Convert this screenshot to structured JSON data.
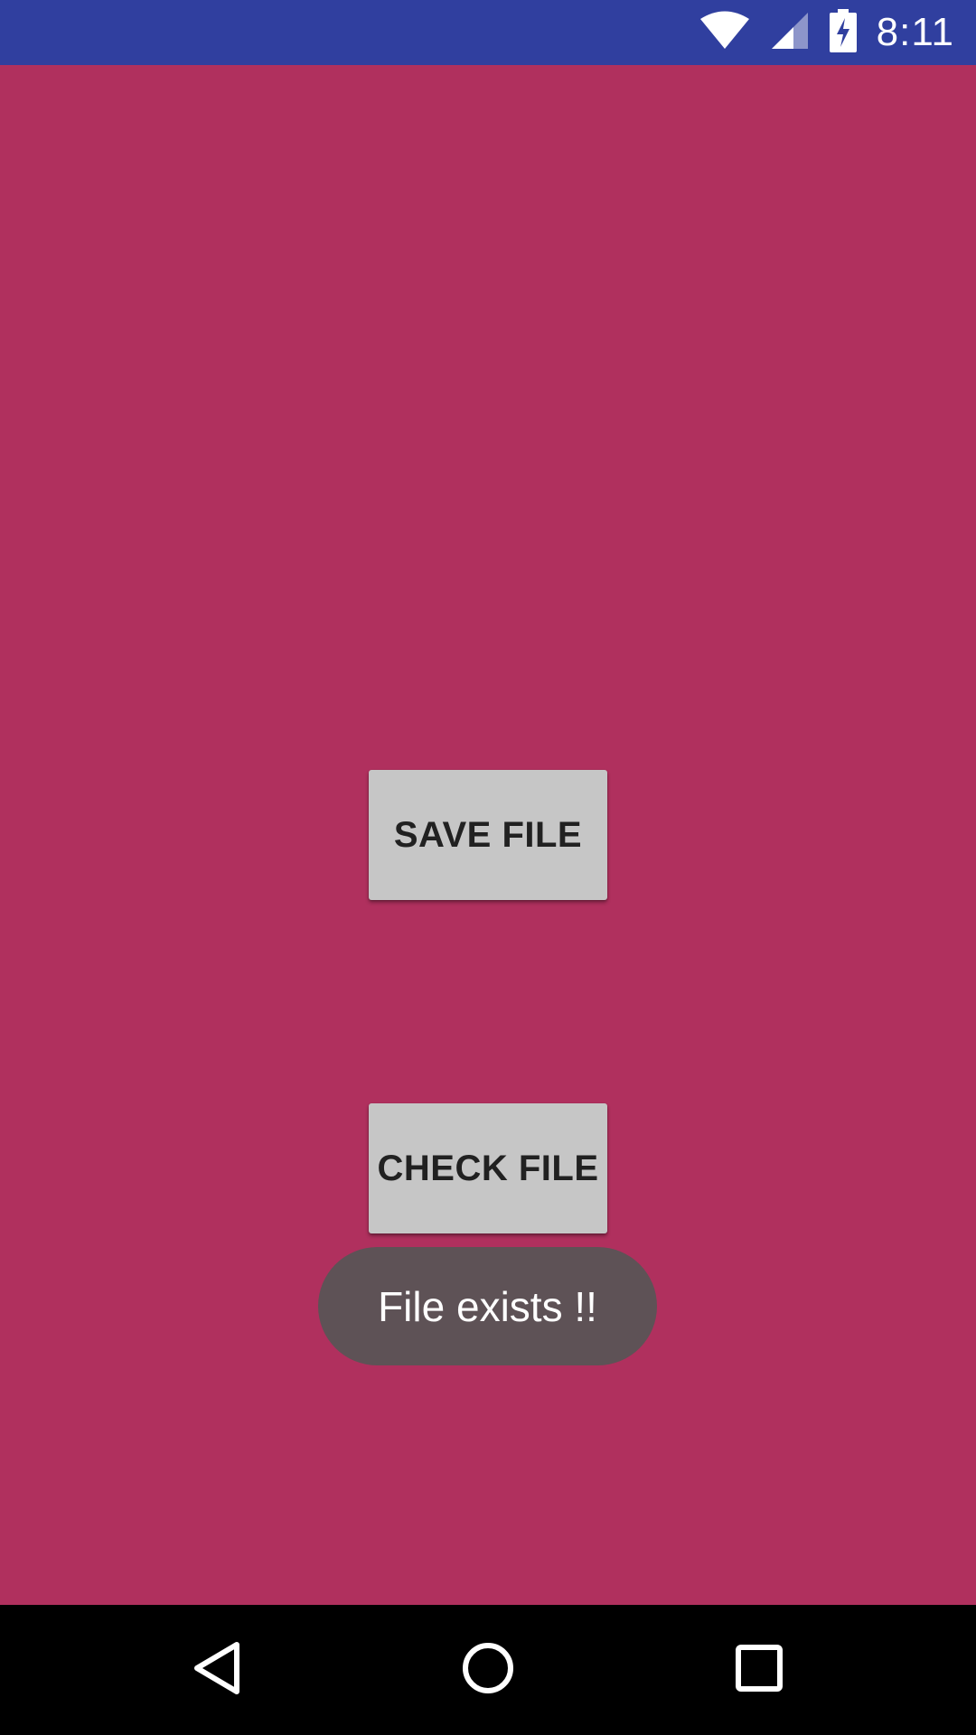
{
  "colors": {
    "status_bar": "#303f9f",
    "background": "#b0305e",
    "button_bg": "#c6c6c6",
    "toast_bg": "#5e5256",
    "nav_bar": "#000000",
    "icon": "#ffffff"
  },
  "status_bar": {
    "time": "8:11",
    "icons": [
      "wifi-icon",
      "cell-signal-icon",
      "battery-charging-icon"
    ]
  },
  "main": {
    "save_button_label": "SAVE FILE",
    "check_button_label": "CHECK FILE"
  },
  "toast": {
    "message": "File exists !!"
  },
  "nav_bar": {
    "icons": [
      "back-icon",
      "home-icon",
      "recents-icon"
    ]
  }
}
